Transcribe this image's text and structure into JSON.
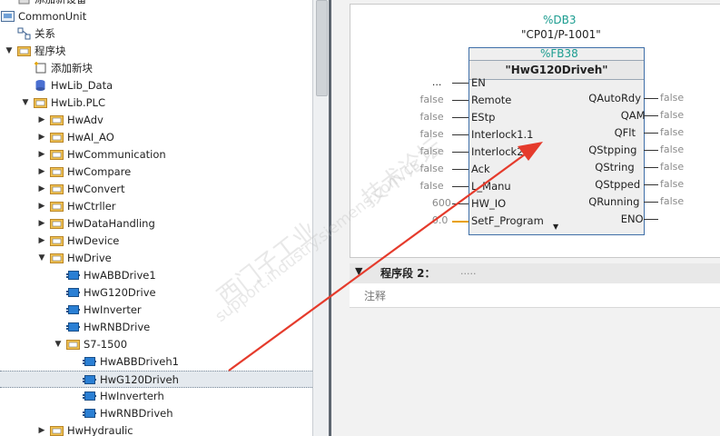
{
  "tree": {
    "rows": [
      {
        "label": "添加新设备",
        "level": 3,
        "icon": "add-device-icon",
        "arrow": ""
      },
      {
        "label": "CommonUnit",
        "level": 2,
        "icon": "unit-icon",
        "arrow": "down"
      },
      {
        "label": "关系",
        "level": 3,
        "icon": "relations-icon",
        "arrow": ""
      },
      {
        "label": "程序块",
        "level": 3,
        "icon": "folder-icon",
        "arrow": "down"
      },
      {
        "label": "添加新块",
        "level": 4,
        "icon": "add-block-icon",
        "arrow": ""
      },
      {
        "label": "HwLib_Data",
        "level": 4,
        "icon": "db-icon",
        "arrow": ""
      },
      {
        "label": "HwLib.PLC",
        "level": 4,
        "icon": "folder-icon",
        "arrow": "down"
      },
      {
        "label": "HwAdv",
        "level": 5,
        "icon": "folder-icon",
        "arrow": "right"
      },
      {
        "label": "HwAI_AO",
        "level": 5,
        "icon": "folder-icon",
        "arrow": "right"
      },
      {
        "label": "HwCommunication",
        "level": 5,
        "icon": "folder-icon",
        "arrow": "right"
      },
      {
        "label": "HwCompare",
        "level": 5,
        "icon": "folder-icon",
        "arrow": "right"
      },
      {
        "label": "HwConvert",
        "level": 5,
        "icon": "folder-icon",
        "arrow": "right"
      },
      {
        "label": "HwCtrller",
        "level": 5,
        "icon": "folder-icon",
        "arrow": "right"
      },
      {
        "label": "HwDataHandling",
        "level": 5,
        "icon": "folder-icon",
        "arrow": "right"
      },
      {
        "label": "HwDevice",
        "level": 5,
        "icon": "folder-icon",
        "arrow": "right"
      },
      {
        "label": "HwDrive",
        "level": 5,
        "icon": "folder-icon",
        "arrow": "down"
      },
      {
        "label": "HwABBDrive1",
        "level": 6,
        "icon": "fb-icon",
        "arrow": ""
      },
      {
        "label": "HwG120Drive",
        "level": 6,
        "icon": "fb-icon",
        "arrow": ""
      },
      {
        "label": "HwInverter",
        "level": 6,
        "icon": "fb-icon",
        "arrow": ""
      },
      {
        "label": "HwRNBDrive",
        "level": 6,
        "icon": "fb-icon",
        "arrow": ""
      },
      {
        "label": "S7-1500",
        "level": 6,
        "icon": "folder-icon",
        "arrow": "down"
      },
      {
        "label": "HwABBDriveh1",
        "level": 7,
        "icon": "fb-icon",
        "arrow": ""
      },
      {
        "label": "HwG120Driveh",
        "level": 7,
        "icon": "fb-icon",
        "arrow": "",
        "selected": true
      },
      {
        "label": "HwInverterh",
        "level": 7,
        "icon": "fb-icon",
        "arrow": ""
      },
      {
        "label": "HwRNBDriveh",
        "level": 7,
        "icon": "fb-icon",
        "arrow": ""
      },
      {
        "label": "HwHydraulic",
        "level": 5,
        "icon": "folder-icon",
        "arrow": "right"
      }
    ]
  },
  "block": {
    "db_name": "%DB3",
    "instance": "\"CP01/P-1001\"",
    "fb_number": "%FB38",
    "fb_name": "\"HwG120Driveh\"",
    "en_value": "...",
    "inputs": [
      {
        "name": "EN",
        "value": "..."
      },
      {
        "name": "Remote",
        "value": "false"
      },
      {
        "name": "EStp",
        "value": "false"
      },
      {
        "name": "Interlock1.1",
        "value": "false"
      },
      {
        "name": "Interlock2.1",
        "value": "false"
      },
      {
        "name": "Ack",
        "value": "false"
      },
      {
        "name": "L_Manu",
        "value": "false"
      },
      {
        "name": "HW_IO",
        "value": "600"
      },
      {
        "name": "SetF_Program",
        "value": "0.0"
      }
    ],
    "outputs": [
      {
        "name": "QAutoRdy",
        "value": "false"
      },
      {
        "name": "QAM",
        "value": "false"
      },
      {
        "name": "QFlt",
        "value": "false"
      },
      {
        "name": "QStpping",
        "value": "false"
      },
      {
        "name": "QString",
        "value": "false"
      },
      {
        "name": "QStpped",
        "value": "false"
      },
      {
        "name": "QRunning",
        "value": "false"
      },
      {
        "name": "ENO",
        "value": ""
      }
    ]
  },
  "segment2": {
    "title": "程序段 2：",
    "dots": ".....",
    "comment": "注释"
  },
  "watermark": {
    "line1": "西门子工业",
    "line2": "support.industry.siemens.com/cs",
    "line3": "技术论坛"
  },
  "colors": {
    "arrow": "#e53b2c",
    "fbBorder": "#3f6fa8",
    "dbText": "#1a9c8f"
  }
}
